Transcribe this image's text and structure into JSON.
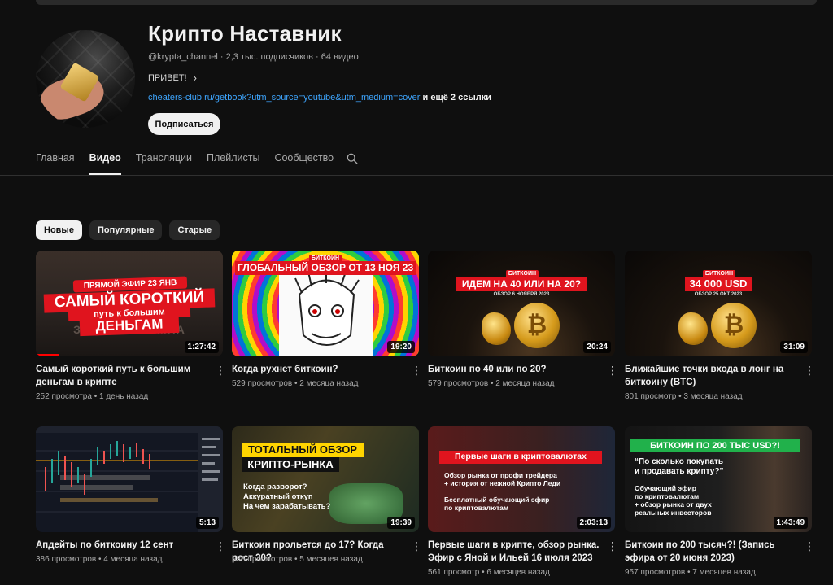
{
  "channel": {
    "name": "Крипто Наставник",
    "handle": "@krypta_channel",
    "subscribers": "2,3 тыс. подписчиков",
    "video_count": "64 видео",
    "description": "ПРИВЕТ!",
    "link": "cheaters-club.ru/getbook?utm_source=youtube&utm_medium=cover",
    "more_links": "и ещё 2 ссылки",
    "subscribe_label": "Подписаться"
  },
  "tabs": [
    {
      "label": "Главная",
      "active": false
    },
    {
      "label": "Видео",
      "active": true
    },
    {
      "label": "Трансляции",
      "active": false
    },
    {
      "label": "Плейлисты",
      "active": false
    },
    {
      "label": "Сообщество",
      "active": false
    }
  ],
  "chips": [
    {
      "label": "Новые",
      "active": true
    },
    {
      "label": "Популярные",
      "active": false
    },
    {
      "label": "Старые",
      "active": false
    }
  ],
  "videos": [
    {
      "title": "Самый короткий путь к большим деньгам в крипте",
      "views": "252 просмотра",
      "age": "1 день назад",
      "duration": "1:27:42",
      "thumb": {
        "line1": "ПРЯМОЙ ЭФИР 23 ЯНВ",
        "line2": "САМЫЙ КОРОТКИЙ",
        "line3": "путь к большим",
        "line4": "ДЕНЬГАМ",
        "bg_text": "ЗАКОНЫ ТРАМПА"
      }
    },
    {
      "title": "Когда рухнет биткоин?",
      "views": "529 просмотров",
      "age": "2 месяца назад",
      "duration": "19:20",
      "thumb": {
        "tag": "БИТКОИН",
        "headline": "ГЛОБАЛЬНЫЙ ОБЗОР ОТ 13 НОЯ 23"
      }
    },
    {
      "title": "Биткоин по 40 или по 20?",
      "views": "579 просмотров",
      "age": "2 месяца назад",
      "duration": "20:24",
      "thumb": {
        "tag": "БИТКОИН",
        "headline": "ИДЕМ НА 40 ИЛИ НА 20?",
        "sub": "ОБЗОР 6 НОЯБРЯ 2023"
      }
    },
    {
      "title": "Ближайшие точки входа в лонг на биткоину (BTC)",
      "views": "801 просмотр",
      "age": "3 месяца назад",
      "duration": "31:09",
      "thumb": {
        "tag": "БИТКОИН",
        "headline": "34 000 USD",
        "sub": "ОБЗОР 25 ОКТ 2023"
      }
    },
    {
      "title": "Апдейты по биткоину 12 сент",
      "views": "386 просмотров",
      "age": "4 месяца назад",
      "duration": "5:13",
      "thumb": {}
    },
    {
      "title": "Биткоин прольется до 17? Когда рост 30?",
      "views": "935 просмотров",
      "age": "5 месяцев назад",
      "duration": "19:39",
      "thumb": {
        "headline1": "ТОТАЛЬНЫЙ ОБЗОР",
        "headline2": "КРИПТО-РЫНКА",
        "q1": "Когда разворот?",
        "q2": "Аккуратный откуп",
        "q3": "На чем зарабатывать?"
      }
    },
    {
      "title": "Первые шаги в крипте, обзор рынка. Эфир с Яной и Ильей 16 июля 2023",
      "views": "561 просмотр",
      "age": "6 месяцев назад",
      "duration": "2:03:13",
      "thumb": {
        "headline": "Первые шаги в криптовалютах",
        "l1": "Обзор рынка от профи трейдера",
        "l2": "+ история от нежной Крипто Леди",
        "l3": "Бесплатный обучающий эфир",
        "l4": "по криптовалютам"
      }
    },
    {
      "title": "Биткоин по 200 тысяч?! (Запись эфира от 20 июня 2023)",
      "views": "957 просмотров",
      "age": "7 месяцев назад",
      "duration": "1:43:49",
      "thumb": {
        "headline": "БИТКОИН ПО 200 ТЫС USD?!",
        "l1": "“По сколько покупать",
        "l2": "и продавать крипту?”",
        "l3": "Обучающий эфир",
        "l4": "по криптовалютам",
        "l5": "+ обзор рынка от двух",
        "l6": "реальных инвесторов"
      }
    }
  ],
  "colors": {
    "background": "#0f0f0f",
    "link": "#3ea6ff",
    "accent_red": "#e0141e",
    "green_badge": "#21b14b"
  }
}
